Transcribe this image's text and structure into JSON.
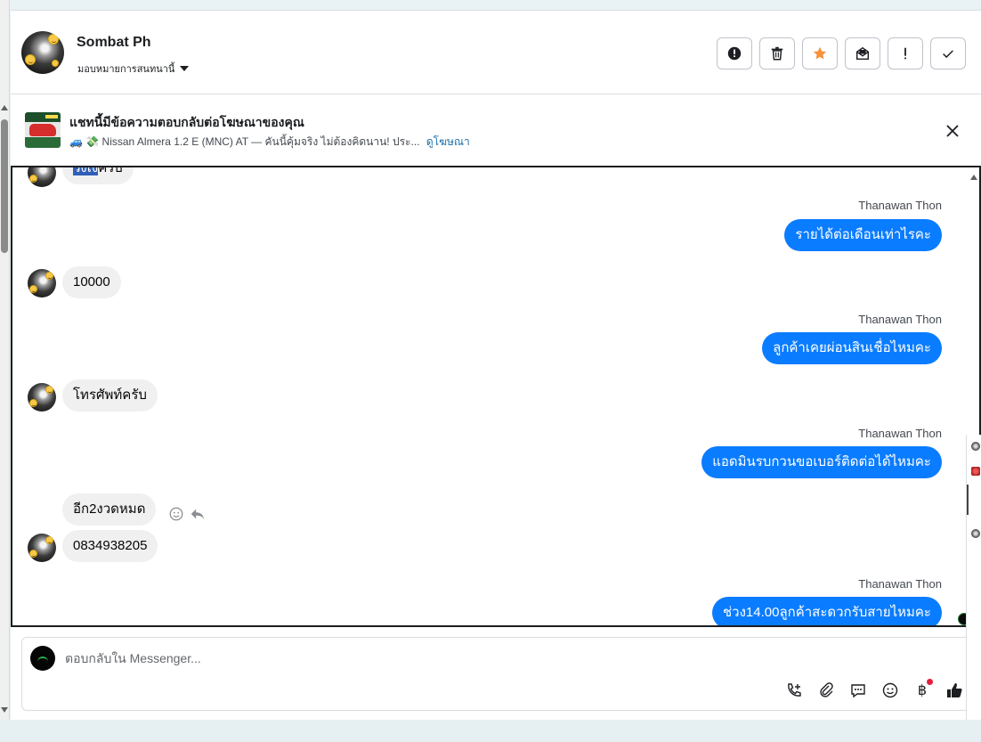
{
  "header": {
    "contact_name": "Sombat Ph",
    "assign_label": "มอบหมายการสนทนานี้",
    "actions": [
      {
        "name": "spam-alert-button",
        "icon": "alert-circle-icon"
      },
      {
        "name": "delete-button",
        "icon": "trash-icon"
      },
      {
        "name": "star-button",
        "icon": "star-icon"
      },
      {
        "name": "mark-unread-button",
        "icon": "envelope-open-icon"
      },
      {
        "name": "follow-up-button",
        "icon": "exclamation-icon"
      },
      {
        "name": "mark-done-button",
        "icon": "check-icon"
      }
    ],
    "star_color": "#f7923b"
  },
  "banner": {
    "title": "แชทนี้มีข้อความตอบกลับต่อโฆษณาของคุณ",
    "subtitle": "🚙 💸 Nissan Almera 1.2 E (MNC) AT — คันนี้คุ้มจริง ไม่ต้องคิดนาน! ประ...",
    "link": "ดูโฆษณา"
  },
  "messages": [
    {
      "dir": "in",
      "text_hl": "วงเง",
      "text": "ครับ",
      "partial": true
    },
    {
      "dir": "out",
      "sender": "Thanawan Thon",
      "text": "รายได้ต่อเดือนเท่าไรคะ"
    },
    {
      "dir": "in",
      "text": "10000"
    },
    {
      "dir": "out",
      "sender": "Thanawan Thon",
      "text": "ลูกค้าเคยผ่อนสินเชื่อไหมคะ"
    },
    {
      "dir": "in",
      "text": "โทรศัพท์ครับ"
    },
    {
      "dir": "out",
      "sender": "Thanawan Thon",
      "text": "แอดมินรบกวนขอเบอร์ติดต่อได้ไหมคะ"
    },
    {
      "dir": "in",
      "text": "อีก2งวดหมด"
    },
    {
      "dir": "in",
      "text": "0834938205"
    },
    {
      "dir": "out",
      "sender": "Thanawan Thon",
      "text": "ช่วง14.00ลูกค้าสะดวกรับสายไหมคะ"
    }
  ],
  "composer": {
    "placeholder": "ตอบกลับใน Messenger...",
    "tools": [
      "phone-add-icon",
      "paperclip-icon",
      "saved-reply-icon",
      "emoji-icon",
      "baht-icon",
      "thumbs-up-icon"
    ],
    "baht_symbol": "฿"
  },
  "colors": {
    "outgoing_bubble": "#0a7cff",
    "incoming_bubble": "#f0f0f0",
    "link": "#1b6ea8"
  }
}
